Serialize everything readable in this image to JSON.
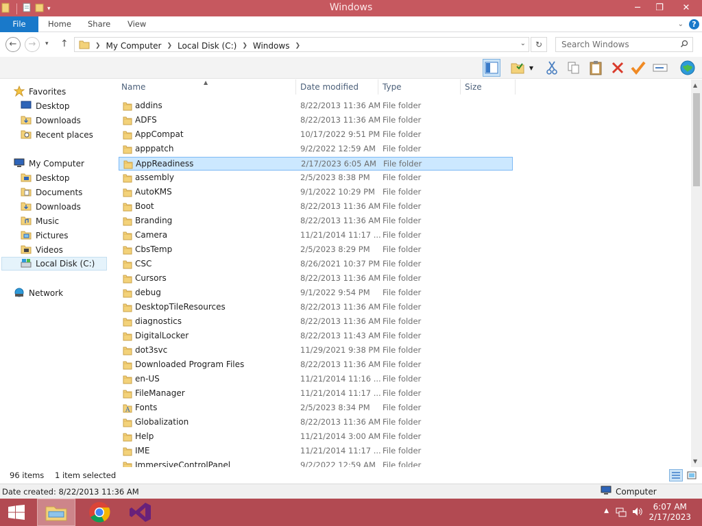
{
  "window": {
    "title": "Windows"
  },
  "ribbon": {
    "tabs": [
      "File",
      "Home",
      "Share",
      "View"
    ],
    "file_color": "#1979ca"
  },
  "address": {
    "crumbs": [
      "My Computer",
      "Local Disk (C:)",
      "Windows"
    ],
    "search_placeholder": "Search Windows"
  },
  "columns": {
    "name": "Name",
    "date": "Date modified",
    "type": "Type",
    "size": "Size"
  },
  "nav": {
    "favorites": "Favorites",
    "fav_items": [
      "Desktop",
      "Downloads",
      "Recent places"
    ],
    "computer": "My Computer",
    "computer_items": [
      "Desktop",
      "Documents",
      "Downloads",
      "Music",
      "Pictures",
      "Videos",
      "Local Disk (C:)"
    ],
    "network": "Network"
  },
  "files": [
    {
      "name": "addins",
      "date": "8/22/2013 11:36 AM",
      "type": "File folder",
      "icon": "folder"
    },
    {
      "name": "ADFS",
      "date": "8/22/2013 11:36 AM",
      "type": "File folder",
      "icon": "folder"
    },
    {
      "name": "AppCompat",
      "date": "10/17/2022 9:51 PM",
      "type": "File folder",
      "icon": "folder"
    },
    {
      "name": "apppatch",
      "date": "9/2/2022 12:59 AM",
      "type": "File folder",
      "icon": "folder"
    },
    {
      "name": "AppReadiness",
      "date": "2/17/2023 6:05 AM",
      "type": "File folder",
      "icon": "folder",
      "selected": true
    },
    {
      "name": "assembly",
      "date": "2/5/2023 8:38 PM",
      "type": "File folder",
      "icon": "folder"
    },
    {
      "name": "AutoKMS",
      "date": "9/1/2022 10:29 PM",
      "type": "File folder",
      "icon": "folder"
    },
    {
      "name": "Boot",
      "date": "8/22/2013 11:36 AM",
      "type": "File folder",
      "icon": "folder"
    },
    {
      "name": "Branding",
      "date": "8/22/2013 11:36 AM",
      "type": "File folder",
      "icon": "folder"
    },
    {
      "name": "Camera",
      "date": "11/21/2014 11:17 ...",
      "type": "File folder",
      "icon": "folder"
    },
    {
      "name": "CbsTemp",
      "date": "2/5/2023 8:29 PM",
      "type": "File folder",
      "icon": "folder"
    },
    {
      "name": "CSC",
      "date": "8/26/2021 10:37 PM",
      "type": "File folder",
      "icon": "folder"
    },
    {
      "name": "Cursors",
      "date": "8/22/2013 11:36 AM",
      "type": "File folder",
      "icon": "folder"
    },
    {
      "name": "debug",
      "date": "9/1/2022 9:54 PM",
      "type": "File folder",
      "icon": "folder"
    },
    {
      "name": "DesktopTileResources",
      "date": "8/22/2013 11:36 AM",
      "type": "File folder",
      "icon": "folder"
    },
    {
      "name": "diagnostics",
      "date": "8/22/2013 11:36 AM",
      "type": "File folder",
      "icon": "folder"
    },
    {
      "name": "DigitalLocker",
      "date": "8/22/2013 11:43 AM",
      "type": "File folder",
      "icon": "folder"
    },
    {
      "name": "dot3svc",
      "date": "11/29/2021 9:38 PM",
      "type": "File folder",
      "icon": "folder"
    },
    {
      "name": "Downloaded Program Files",
      "date": "8/22/2013 11:36 AM",
      "type": "File folder",
      "icon": "folder"
    },
    {
      "name": "en-US",
      "date": "11/21/2014 11:16 ...",
      "type": "File folder",
      "icon": "folder"
    },
    {
      "name": "FileManager",
      "date": "11/21/2014 11:17 ...",
      "type": "File folder",
      "icon": "folder"
    },
    {
      "name": "Fonts",
      "date": "2/5/2023 8:34 PM",
      "type": "File folder",
      "icon": "fonts-folder"
    },
    {
      "name": "Globalization",
      "date": "8/22/2013 11:36 AM",
      "type": "File folder",
      "icon": "folder"
    },
    {
      "name": "Help",
      "date": "11/21/2014 3:00 AM",
      "type": "File folder",
      "icon": "folder"
    },
    {
      "name": "IME",
      "date": "11/21/2014 11:17 ...",
      "type": "File folder",
      "icon": "folder"
    },
    {
      "name": "ImmersiveControlPanel",
      "date": "9/2/2022 12:59 AM",
      "type": "File folder",
      "icon": "folder"
    }
  ],
  "status": {
    "count": "96 items",
    "selected": "1 item selected"
  },
  "details": {
    "date_created": "Date created: 8/22/2013 11:36 AM",
    "location": "Computer"
  },
  "clock": {
    "time": "6:07 AM",
    "date": "2/17/2023"
  }
}
